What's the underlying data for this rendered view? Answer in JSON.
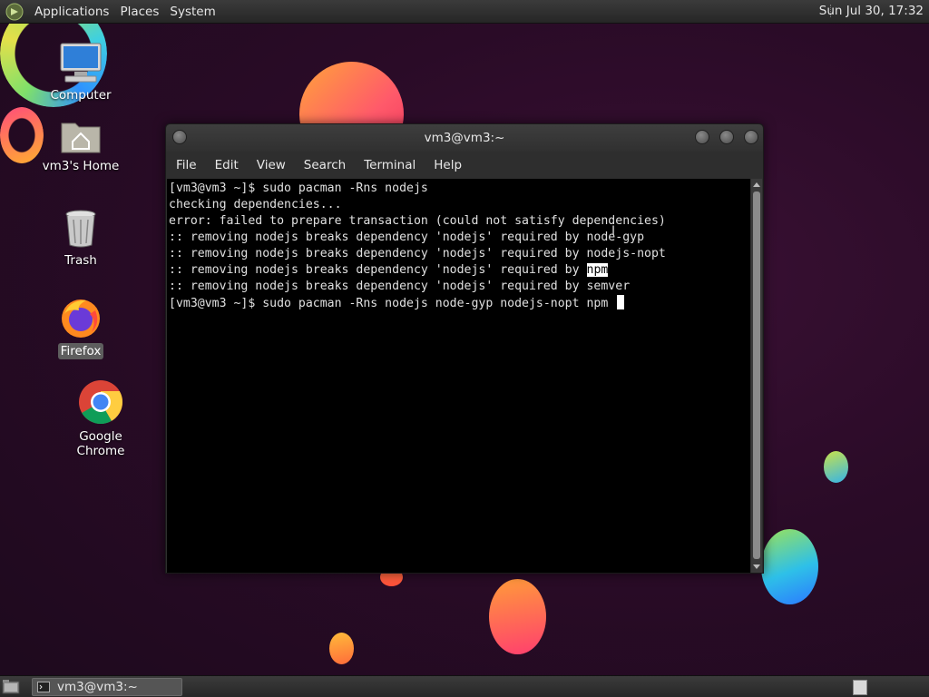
{
  "top_panel": {
    "menus": [
      "Applications",
      "Places",
      "System"
    ],
    "clock": "Sun Jul 30, 17:32"
  },
  "desktop_icons": {
    "computer": "Computer",
    "home": "vm3's Home",
    "trash": "Trash",
    "firefox": "Firefox",
    "chrome": "Google Chrome"
  },
  "terminal": {
    "title": "vm3@vm3:~",
    "menu": [
      "File",
      "Edit",
      "View",
      "Search",
      "Terminal",
      "Help"
    ],
    "lines": [
      "[vm3@vm3 ~]$ sudo pacman -Rns nodejs",
      "checking dependencies...",
      "error: failed to prepare transaction (could not satisfy dependencies)",
      ":: removing nodejs breaks dependency 'nodejs' required by node-gyp",
      ":: removing nodejs breaks dependency 'nodejs' required by nodejs-nopt",
      ":: removing nodejs breaks dependency 'nodejs' required by ",
      ":: removing nodejs breaks dependency 'nodejs' required by semver",
      "[vm3@vm3 ~]$ sudo pacman -Rns nodejs node-gyp nodejs-nopt npm "
    ],
    "highlighted_word": "npm"
  },
  "taskbar": {
    "window_button": "vm3@vm3:~"
  },
  "colors": {
    "terminal_bg": "#000000",
    "terminal_fg": "#e0e0e0",
    "panel_bg": "#2c2c2c",
    "selection_bg": "#ffffff"
  }
}
